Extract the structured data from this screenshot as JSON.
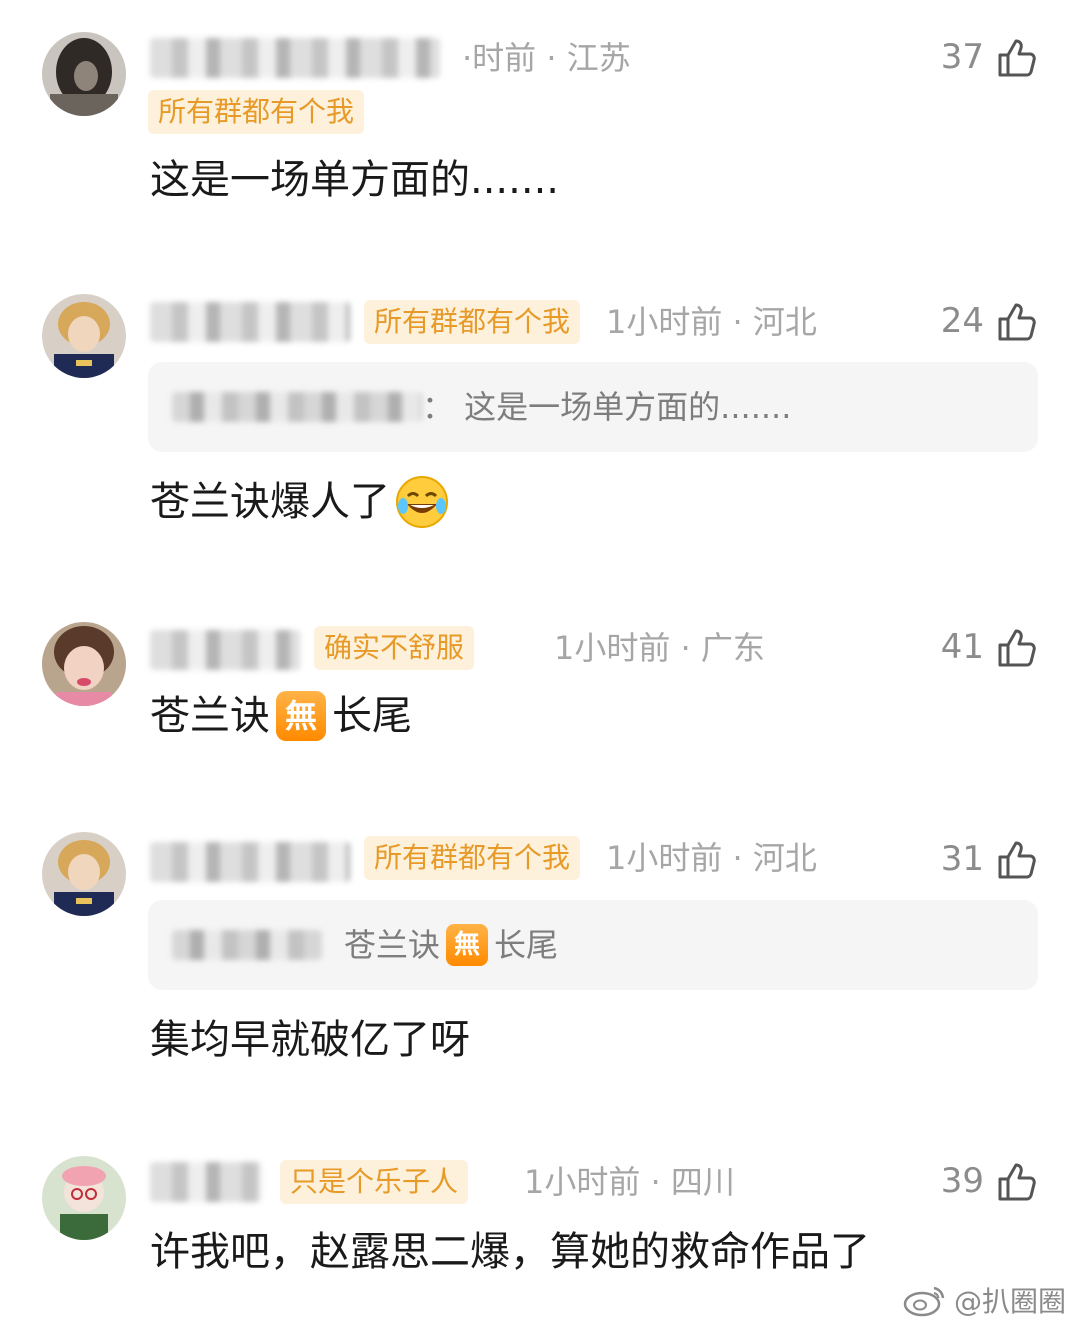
{
  "comments": [
    {
      "badge": "所有群都有个我",
      "meta": "·时前 · 江苏",
      "likes": "37",
      "content": "这是一场单方面的.......",
      "avatar_color": "#2f2a26"
    },
    {
      "badge": "所有群都有个我",
      "meta": "1小时前 · 河北",
      "likes": "24",
      "reply": "： 这是一场单方面的.......",
      "content": "苍兰诀爆人了",
      "avatar_color": "#1f2a55"
    },
    {
      "badge": "确实不舒服",
      "meta": "1小时前 · 广东",
      "likes": "41",
      "content_a": "苍兰诀",
      "emoji": "無",
      "content_b": "长尾",
      "avatar_color": "#d9b89a"
    },
    {
      "badge": "所有群都有个我",
      "meta": "1小时前 · 河北",
      "likes": "31",
      "reply_a": "苍兰诀",
      "reply_emoji": "無",
      "reply_b": "长尾",
      "content": "集均早就破亿了呀",
      "avatar_color": "#1f2a55"
    },
    {
      "badge": "只是个乐子人",
      "meta": "1小时前 · 四川",
      "likes": "39",
      "content": "许我吧，赵露思二爆，算她的救命作品了",
      "avatar_color": "#e9c7c4"
    }
  ],
  "watermark": "@扒圈圈",
  "colors": {
    "badge_bg": "#fdf1dc",
    "badge_text": "#e79a27",
    "meta": "#a6a6a6",
    "reply_bg": "#f5f5f5"
  }
}
